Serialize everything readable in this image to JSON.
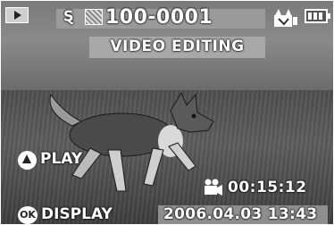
{
  "top": {
    "frame_icon": "playback-frame-icon",
    "memory_icon": "memory-card-icon",
    "memory_symbol": "Ȿ",
    "thumb_icon": "image-thumbnail-icon",
    "file_number": "100-0001",
    "edit_icon": "edit-movie-icon",
    "battery_icon": "battery-full-icon"
  },
  "mode": {
    "title": "VIDEO EDITING"
  },
  "controls": {
    "play_icon": "up-arrow-button-icon",
    "play_label": "PLAY",
    "ok_icon_label": "OK",
    "display_label": "DISPLAY"
  },
  "status": {
    "movie_icon": "movie-camera-icon",
    "duration": "00:15:12",
    "datetime": "2006.04.03 13:43"
  },
  "colors": {
    "overlay_bar": "#9a9a9a",
    "text": "#ffffff"
  }
}
